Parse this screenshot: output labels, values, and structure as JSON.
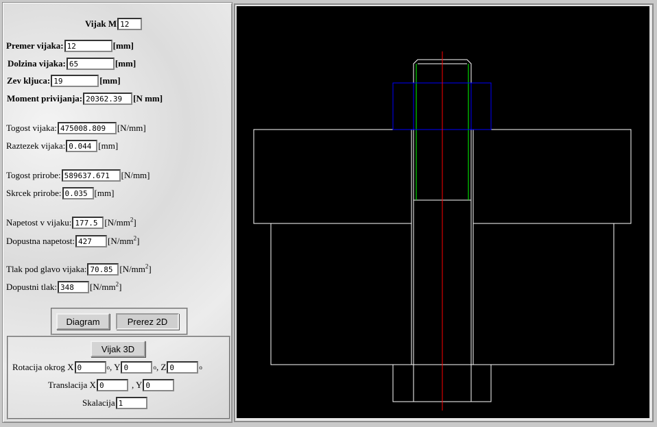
{
  "form": {
    "vijak_m": {
      "label": "Vijak M",
      "value": "12"
    },
    "premer": {
      "label": "Premer vijaka:",
      "value": "12",
      "unit": "[mm]"
    },
    "dolzina": {
      "label": "Dolzina vijaka:",
      "value": "65",
      "unit": "[mm]"
    },
    "zev": {
      "label": "Zev kljuca:",
      "value": "19",
      "unit": "[mm]"
    },
    "moment": {
      "label": "Moment privijanja:",
      "value": "20362.39",
      "unit": "[N mm]"
    },
    "togost_vijaka": {
      "label": "Togost vijaka:",
      "value": "475008.809",
      "unit": "[N/mm]"
    },
    "raztezek": {
      "label": "Raztezek vijaka:",
      "value": "0.044",
      "unit": "[mm]"
    },
    "togost_prirobe": {
      "label": "Togost prirobe:",
      "value": "589637.671",
      "unit": "[N/mm]"
    },
    "skrcek": {
      "label": "Skrcek prirobe:",
      "value": "0.035",
      "unit": "[mm]"
    },
    "napetost": {
      "label": "Napetost v vijaku:",
      "value": "177.5",
      "unit": "[N/mm",
      "unit_sup": "2",
      "unit_end": "]"
    },
    "dop_napetost": {
      "label": "Dopustna napetost:",
      "value": "427",
      "unit": "[N/mm",
      "unit_sup": "2",
      "unit_end": "]"
    },
    "tlak": {
      "label": "Tlak pod glavo vijaka:",
      "value": "70.85",
      "unit": "[N/mm",
      "unit_sup": "2",
      "unit_end": "]"
    },
    "dop_tlak": {
      "label": "Dopustni tlak:",
      "value": "348",
      "unit": "[N/mm",
      "unit_sup": "2",
      "unit_end": "]"
    }
  },
  "buttons": {
    "diagram": "Diagram",
    "prerez2d": "Prerez 2D",
    "vijak3d": "Vijak 3D"
  },
  "view3d": {
    "rot_label": "Rotacija okrog X",
    "rot_x": "0",
    "deg": "o",
    "y_sep": ", Y",
    "rot_y": "0",
    "z_sep": ", Z",
    "rot_z": "0",
    "trans_label": "Translacija X",
    "trans_x": "0",
    "trans_y_sep": ", Y",
    "trans_y": "0",
    "scale_label": "Skalacija",
    "scale": "1"
  },
  "colors": {
    "canvas_bg": "#000000",
    "outline": "#ffffff",
    "nut": "#0000ff",
    "thread": "#00ff00",
    "axis": "#ff0000"
  }
}
